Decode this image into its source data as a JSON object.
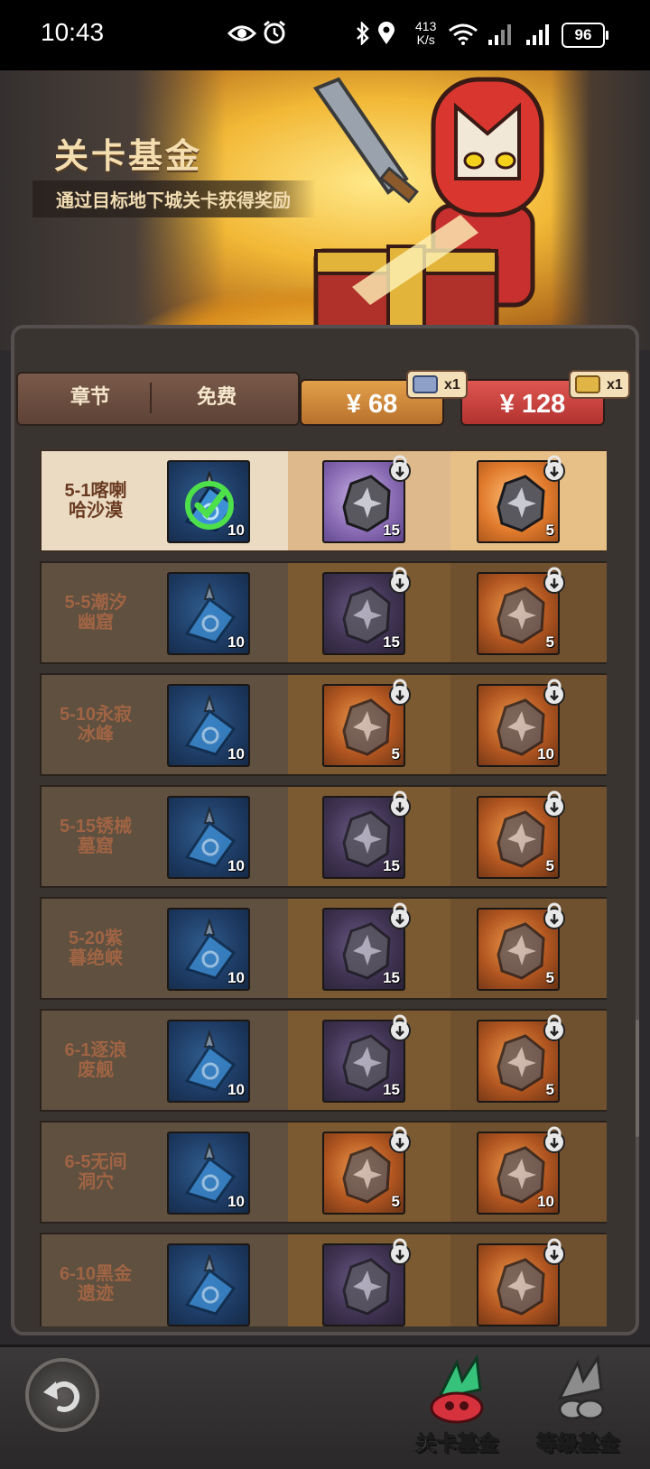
{
  "status_bar": {
    "time": "10:43",
    "net_speed_value": "413",
    "net_speed_unit": "K/s",
    "battery": "96"
  },
  "banner": {
    "title": "关卡基金",
    "subtitle": "通过目标地下城关卡获得奖励"
  },
  "table_header": {
    "chapter": "章节",
    "free": "免费",
    "price_1": "¥ 68",
    "price_2": "¥ 128",
    "bonus_1": "x1",
    "bonus_2": "x1"
  },
  "rows": [
    {
      "label_1": "5-1喀喇",
      "label_2": "哈沙漠",
      "free": "10",
      "p1": "15",
      "p1_color": "purple",
      "p2": "5",
      "p2_color": "orange",
      "claimed": true
    },
    {
      "label_1": "5-5潮汐",
      "label_2": "幽窟",
      "free": "10",
      "p1": "15",
      "p1_color": "purple",
      "p2": "5",
      "p2_color": "orange"
    },
    {
      "label_1": "5-10永寂",
      "label_2": "冰峰",
      "free": "10",
      "p1": "5",
      "p1_color": "orange",
      "p2": "10",
      "p2_color": "orange"
    },
    {
      "label_1": "5-15锈械",
      "label_2": "墓窟",
      "free": "10",
      "p1": "15",
      "p1_color": "purple",
      "p2": "5",
      "p2_color": "orange"
    },
    {
      "label_1": "5-20紫",
      "label_2": "暮绝峡",
      "free": "10",
      "p1": "15",
      "p1_color": "purple",
      "p2": "5",
      "p2_color": "orange"
    },
    {
      "label_1": "6-1逐浪",
      "label_2": "废舰",
      "free": "10",
      "p1": "15",
      "p1_color": "purple",
      "p2": "5",
      "p2_color": "orange"
    },
    {
      "label_1": "6-5无间",
      "label_2": "洞穴",
      "free": "10",
      "p1": "5",
      "p1_color": "orange",
      "p2": "10",
      "p2_color": "orange"
    },
    {
      "label_1": "6-10黑金",
      "label_2": "遗迹",
      "free": "",
      "p1": "",
      "p1_color": "purple",
      "p2": "",
      "p2_color": "orange"
    }
  ],
  "bottom_nav": {
    "stage_fund": "关卡基金",
    "level_fund": "等级基金"
  },
  "icons": {
    "back": "back-arrow-icon",
    "stage_fund": "stage-fund-icon",
    "level_fund": "level-fund-icon",
    "free_item": "blue-potion-icon",
    "paid_item": "ore-gem-icon",
    "locked": "lock-icon",
    "claimed": "check-icon"
  }
}
